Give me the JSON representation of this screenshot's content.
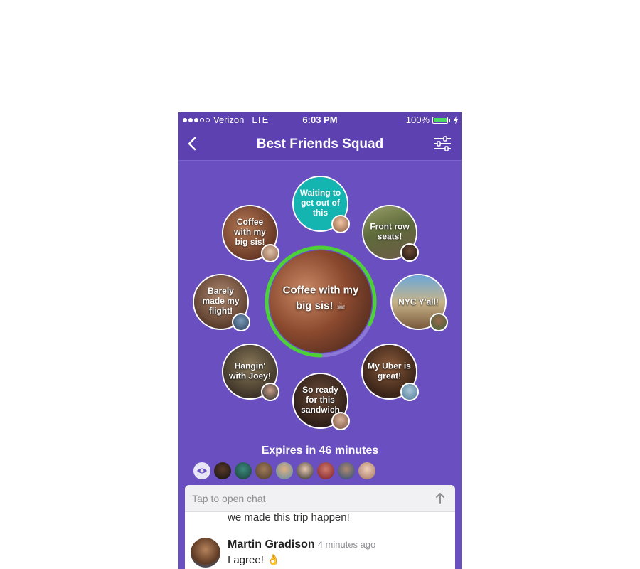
{
  "status_bar": {
    "carrier": "Verizon",
    "network": "LTE",
    "time": "6:03 PM",
    "battery": "100%",
    "battery_color": "#4cd964"
  },
  "nav": {
    "back_icon": "chevron-left-icon",
    "title": "Best Friends Squad",
    "settings_icon": "sliders-icon"
  },
  "center_story": {
    "caption": "Coffee with my big sis! ☕",
    "progress": 0.82,
    "ring_color": "#4cd137"
  },
  "stories": [
    {
      "caption": "Waiting to get out of this"
    },
    {
      "caption": "Front row seats!"
    },
    {
      "caption": "NYC Y'all!"
    },
    {
      "caption": "My Uber is great!"
    },
    {
      "caption": "So ready for this sandwich"
    },
    {
      "caption": "Hangin' with Joey!"
    },
    {
      "caption": "Barely made my flight!"
    },
    {
      "caption": "Coffee with my big sis!"
    }
  ],
  "expires_text": "Expires in 46 minutes",
  "viewers_icon": "eye-icon",
  "chat": {
    "placeholder": "Tap to open chat",
    "send_icon": "arrow-up-icon",
    "previous_message": "we made this trip happen!",
    "message": {
      "author": "Martin Gradison",
      "time": "4 minutes ago",
      "text": "I agree! 👌"
    }
  },
  "colors": {
    "background": "#6a4fc1",
    "header": "#5d41b0",
    "story_teal": "#14b5b0"
  }
}
